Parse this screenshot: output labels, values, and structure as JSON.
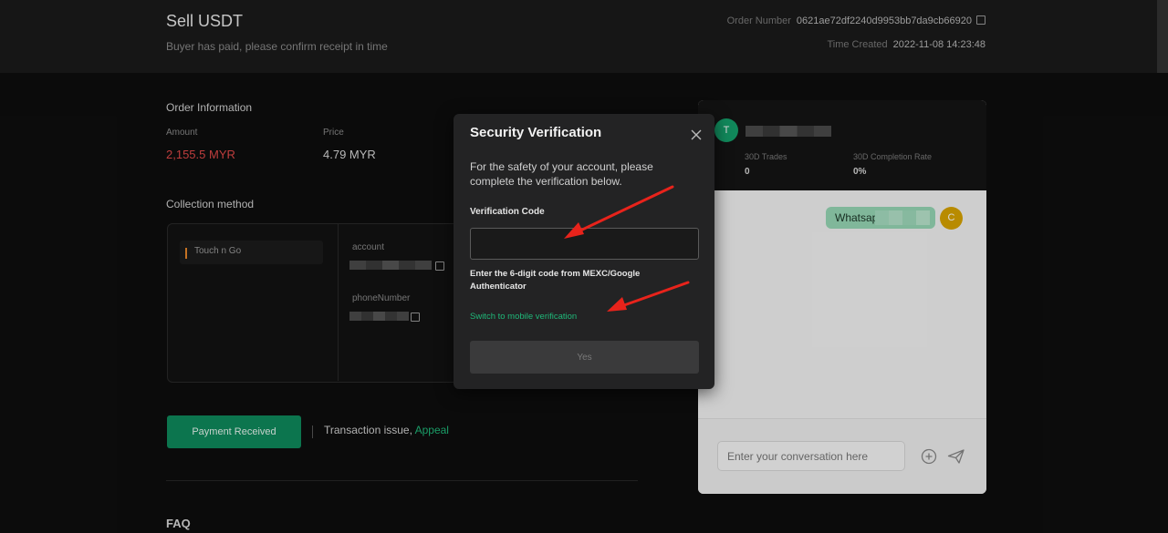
{
  "header": {
    "title": "Sell USDT",
    "subtitle": "Buyer has paid, please confirm receipt in time",
    "order_number_label": "Order Number",
    "order_number": "0621ae72df2240d9953bb7da9cb66920",
    "time_created_label": "Time Created",
    "time_created": "2022-11-08 14:23:48"
  },
  "order_info": {
    "title": "Order Information",
    "amount_label": "Amount",
    "amount_value": "2,155.5 MYR",
    "price_label": "Price",
    "price_value": "4.79 MYR"
  },
  "collection": {
    "title": "Collection method",
    "method": "Touch n Go",
    "account_label": "account",
    "phone_label": "phoneNumber"
  },
  "actions": {
    "payment_received": "Payment Received",
    "transaction_issue": "Transaction issue, ",
    "appeal": "Appeal"
  },
  "faq": {
    "title": "FAQ"
  },
  "chat": {
    "avatar_letter": "T",
    "trades_label": "30D Trades",
    "trades_value": "0",
    "completion_label": "30D Completion Rate",
    "completion_value": "0%",
    "message": "Whatsapp",
    "user_avatar": "C",
    "input_placeholder": "Enter your conversation here"
  },
  "modal": {
    "title": "Security Verification",
    "description": "For the safety of your account, please complete the verification below.",
    "code_label": "Verification Code",
    "code_value": "",
    "hint": "Enter the 6-digit code from MEXC/Google Authenticator",
    "switch_link": "Switch to mobile verification",
    "yes_button": "Yes"
  },
  "colors": {
    "accent_green": "#1fb879",
    "button_green": "#0f8a5c",
    "amount_red": "#e04848",
    "arrow_red": "#e8231b"
  },
  "icons": [
    "copy-icon",
    "close-icon",
    "plus-circle-icon",
    "send-icon",
    "arrow-annotation"
  ]
}
